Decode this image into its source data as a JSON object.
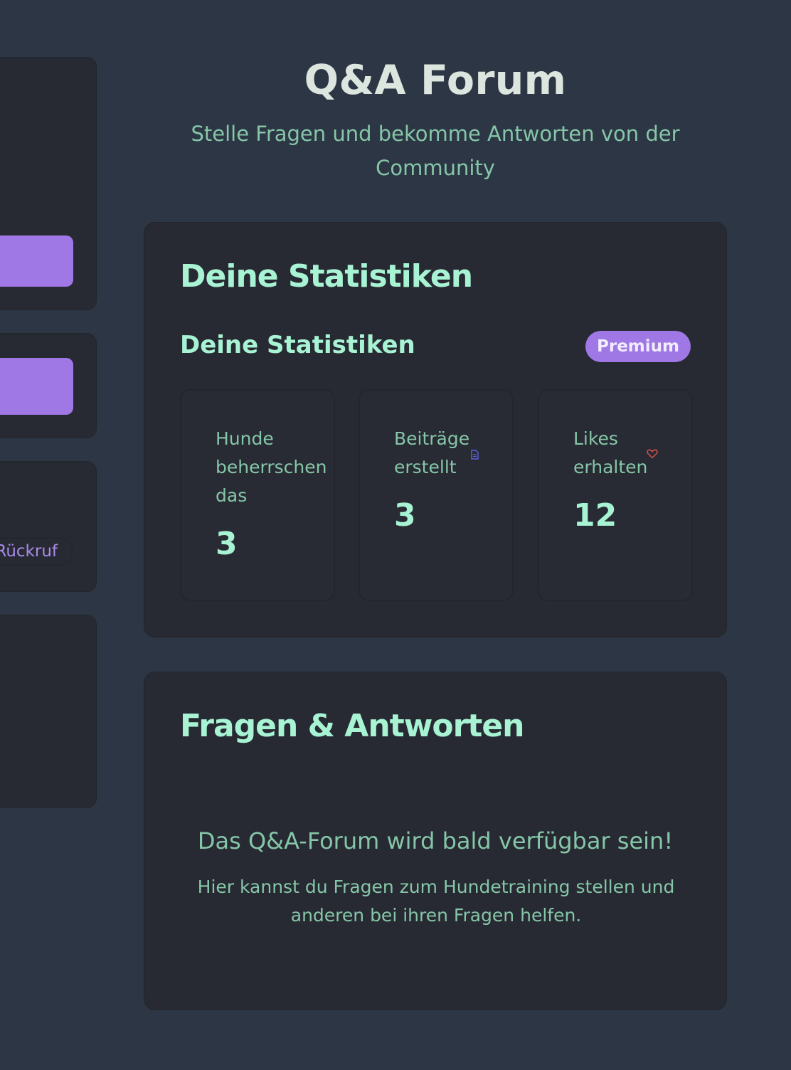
{
  "sidebar": {
    "callback_label": "Rückruf"
  },
  "header": {
    "title": "Q&A Forum",
    "subtitle": "Stelle Fragen und bekomme Antworten von der Community"
  },
  "stats_card": {
    "title": "Deine Statistiken",
    "subtitle": "Deine Statistiken",
    "badge": "Premium",
    "items": [
      {
        "label": "Hunde beherrschen das",
        "value": "3",
        "icon": null
      },
      {
        "label": "Beiträge erstellt",
        "value": "3",
        "icon": "document-icon"
      },
      {
        "label": "Likes erhalten",
        "value": "12",
        "icon": "heart-icon"
      }
    ]
  },
  "forum_card": {
    "title": "Fragen & Antworten",
    "empty_title": "Das Q&A-Forum wird bald verfügbar sein!",
    "empty_description": "Hier kannst du Fragen zum Hundetraining stellen und anderen bei ihren Fragen helfen."
  },
  "colors": {
    "background": "#2c3644",
    "card": "#272a32",
    "accent_green": "#a7f3d3",
    "muted_green": "#86c6a8",
    "purple": "#9f78e6",
    "doc_icon": "#5b63e0",
    "heart_icon": "#e0524a"
  }
}
